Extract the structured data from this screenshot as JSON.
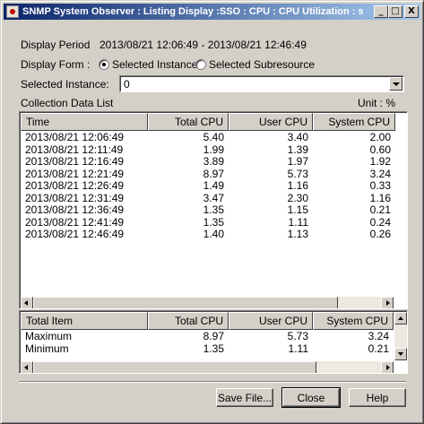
{
  "window": {
    "title": "SNMP System Observer : Listing Display :SSO : CPU : CPU Utilization : ssow...",
    "minimize": "_",
    "maximize": "□",
    "close": "X"
  },
  "display_period": {
    "label": "Display Period",
    "value": "2013/08/21 12:06:49 - 2013/08/21 12:46:49"
  },
  "display_form": {
    "label": "Display Form :",
    "option_instance": "Selected Instance",
    "option_subresource": "Selected Subresource"
  },
  "selected_instance": {
    "label": "Selected Instance:",
    "value": "0"
  },
  "collection": {
    "label": "Collection Data List",
    "unit": "Unit : %",
    "columns": [
      "Time",
      "Total CPU",
      "User CPU",
      "System CPU"
    ],
    "rows": [
      [
        "2013/08/21 12:06:49",
        "5.40",
        "3.40",
        "2.00"
      ],
      [
        "2013/08/21 12:11:49",
        "1.99",
        "1.39",
        "0.60"
      ],
      [
        "2013/08/21 12:16:49",
        "3.89",
        "1.97",
        "1.92"
      ],
      [
        "2013/08/21 12:21:49",
        "8.97",
        "5.73",
        "3.24"
      ],
      [
        "2013/08/21 12:26:49",
        "1.49",
        "1.16",
        "0.33"
      ],
      [
        "2013/08/21 12:31:49",
        "3.47",
        "2.30",
        "1.16"
      ],
      [
        "2013/08/21 12:36:49",
        "1.35",
        "1.15",
        "0.21"
      ],
      [
        "2013/08/21 12:41:49",
        "1.35",
        "1.11",
        "0.24"
      ],
      [
        "2013/08/21 12:46:49",
        "1.40",
        "1.13",
        "0.26"
      ]
    ]
  },
  "summary": {
    "columns": [
      "Total Item",
      "Total CPU",
      "User CPU",
      "System CPU"
    ],
    "rows": [
      [
        "Maximum",
        "8.97",
        "5.73",
        "3.24"
      ],
      [
        "Minimum",
        "1.35",
        "1.11",
        "0.21"
      ]
    ]
  },
  "buttons": {
    "save": "Save File...",
    "close": "Close",
    "help": "Help"
  }
}
